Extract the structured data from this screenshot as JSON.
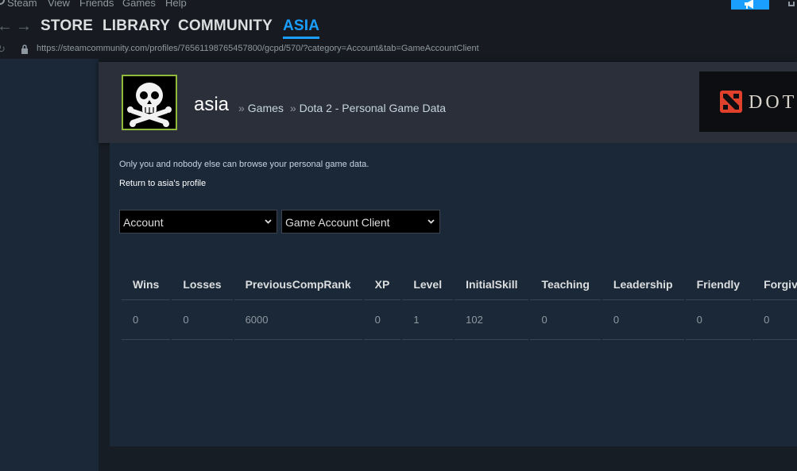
{
  "menu": [
    "Steam",
    "View",
    "Friends",
    "Games",
    "Help"
  ],
  "nav": {
    "back": "←",
    "forward": "→",
    "store": "STORE",
    "library": "LIBRARY",
    "community": "COMMUNITY",
    "user": "ASIA"
  },
  "url": "https://steamcommunity.com/profiles/76561198765457800/gcpd/570/?category=Account&tab=GameAccountClient",
  "profile": {
    "name": "asia",
    "crumb_sep": "»",
    "crumb_games": "Games",
    "crumb_page": "Dota 2 - Personal Game Data",
    "game_logo_text": "DOT"
  },
  "page": {
    "privacy_note": "Only you and nobody else can browse your personal game data.",
    "back_link": "Return to asia's profile",
    "category_select": "Account",
    "tab_select": "Game Account Client"
  },
  "table": {
    "columns": [
      "Wins",
      "Losses",
      "PreviousCompRank",
      "XP",
      "Level",
      "InitialSkill",
      "Teaching",
      "Leadership",
      "Friendly",
      "Forgiving"
    ],
    "row": [
      "0",
      "0",
      "6000",
      "0",
      "1",
      "102",
      "0",
      "0",
      "0",
      "0"
    ]
  },
  "colors": {
    "accent": "#1a9fff",
    "avatar_border": "#90ba3c",
    "dota_red": "#e0412c"
  }
}
